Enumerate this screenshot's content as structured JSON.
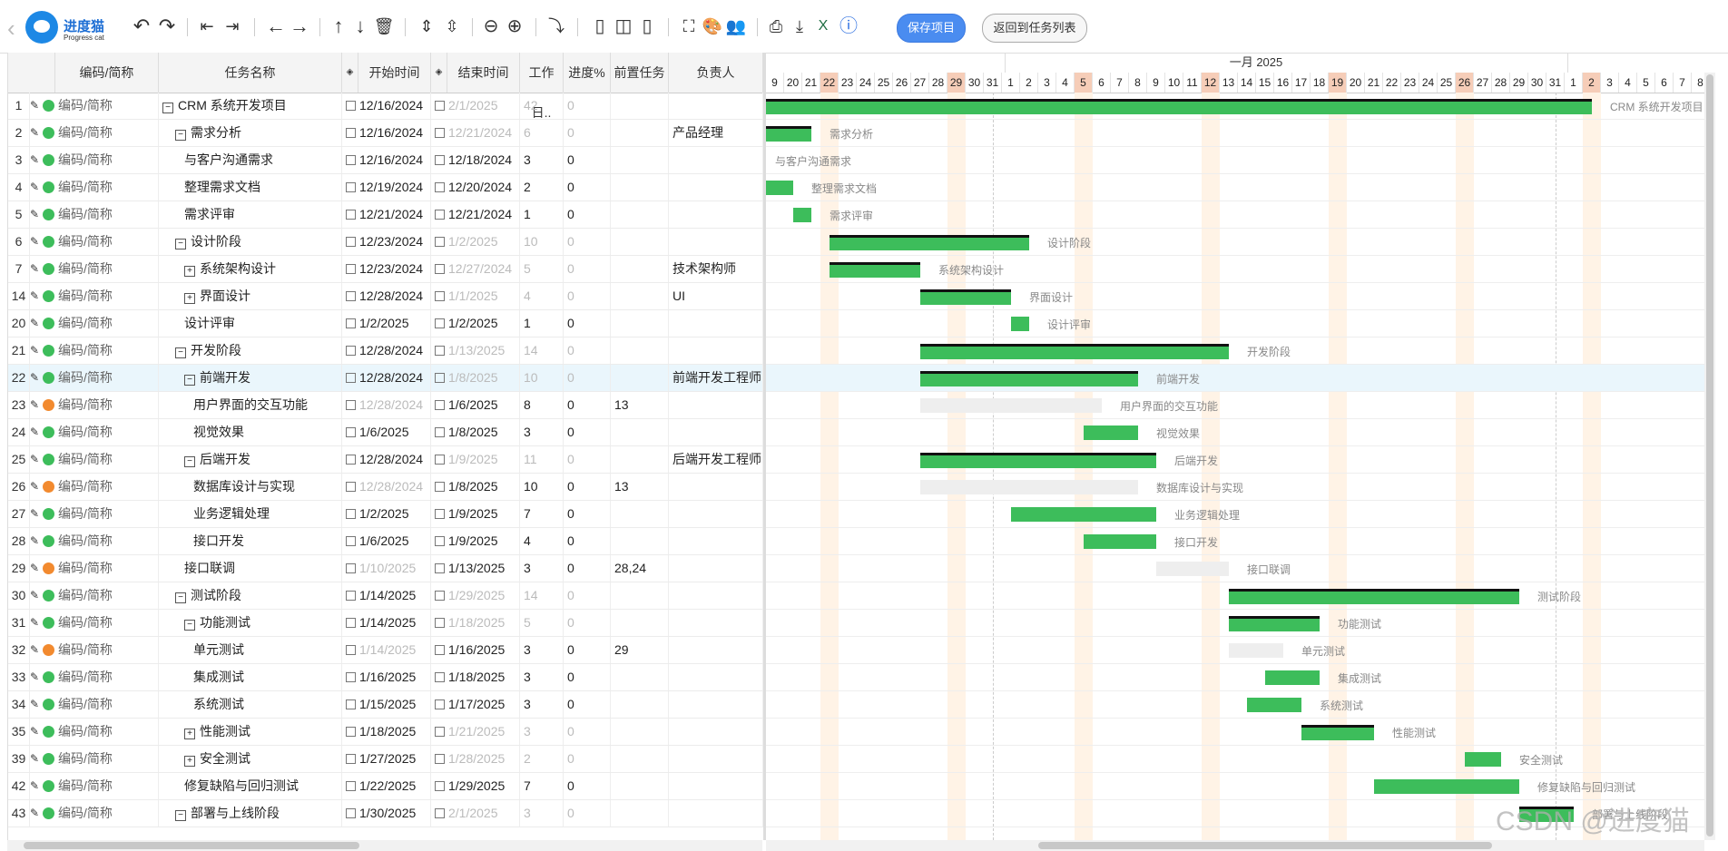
{
  "app": {
    "logo_name": "进度猫",
    "logo_sub": "Progress cat",
    "save_label": "保存项目",
    "back_label": "返回到任务列表"
  },
  "toolbar_icons": [
    "undo-icon",
    "redo-icon",
    "outdent-icon",
    "indent-icon",
    "move-left-icon",
    "move-right-icon",
    "move-up-icon",
    "move-down-icon",
    "delete-icon",
    "expand-rows-icon",
    "collapse-rows-icon",
    "zoom-out-icon",
    "zoom-in-icon",
    "share-icon",
    "layout-left-icon",
    "layout-split-icon",
    "layout-right-icon",
    "fullscreen-icon",
    "palette-icon",
    "users-icon",
    "print-icon",
    "download-icon",
    "excel-icon",
    "help-icon"
  ],
  "grid": {
    "headers": [
      "编码/简称",
      "任务名称",
      "开始时间",
      "结束时间",
      "工作日..",
      "进度%",
      "前置任务",
      "负责人"
    ],
    "rows": [
      {
        "id": "1",
        "status": "green",
        "code": "编码/简称",
        "toggle": "minus",
        "indent": 0,
        "name": "CRM 系统开发项目",
        "start": "12/16/2024",
        "end": "2/1/2025",
        "days": "42",
        "progress": "0",
        "pred": "",
        "owner": "",
        "start_dim": false,
        "end_dim": true,
        "days_dim": true
      },
      {
        "id": "2",
        "status": "green",
        "code": "编码/简称",
        "toggle": "minus",
        "indent": 1,
        "name": "需求分析",
        "start": "12/16/2024",
        "end": "12/21/2024",
        "days": "6",
        "progress": "0",
        "pred": "",
        "owner": "产品经理",
        "start_dim": false,
        "end_dim": true,
        "days_dim": true
      },
      {
        "id": "3",
        "status": "green",
        "code": "编码/简称",
        "toggle": "",
        "indent": 2,
        "name": "与客户沟通需求",
        "start": "12/16/2024",
        "end": "12/18/2024",
        "days": "3",
        "progress": "0",
        "pred": "",
        "owner": "",
        "start_dim": false,
        "end_dim": false,
        "days_dim": false
      },
      {
        "id": "4",
        "status": "green",
        "code": "编码/简称",
        "toggle": "",
        "indent": 2,
        "name": "整理需求文档",
        "start": "12/19/2024",
        "end": "12/20/2024",
        "days": "2",
        "progress": "0",
        "pred": "",
        "owner": "",
        "start_dim": false,
        "end_dim": false,
        "days_dim": false
      },
      {
        "id": "5",
        "status": "green",
        "code": "编码/简称",
        "toggle": "",
        "indent": 2,
        "name": "需求评审",
        "start": "12/21/2024",
        "end": "12/21/2024",
        "days": "1",
        "progress": "0",
        "pred": "",
        "owner": "",
        "start_dim": false,
        "end_dim": false,
        "days_dim": false
      },
      {
        "id": "6",
        "status": "green",
        "code": "编码/简称",
        "toggle": "minus",
        "indent": 1,
        "name": "设计阶段",
        "start": "12/23/2024",
        "end": "1/2/2025",
        "days": "10",
        "progress": "0",
        "pred": "",
        "owner": "",
        "start_dim": false,
        "end_dim": true,
        "days_dim": true
      },
      {
        "id": "7",
        "status": "green",
        "code": "编码/简称",
        "toggle": "plus",
        "indent": 2,
        "name": "系统架构设计",
        "start": "12/23/2024",
        "end": "12/27/2024",
        "days": "5",
        "progress": "0",
        "pred": "",
        "owner": "技术架构师",
        "start_dim": false,
        "end_dim": true,
        "days_dim": true
      },
      {
        "id": "14",
        "status": "green",
        "code": "编码/简称",
        "toggle": "plus",
        "indent": 2,
        "name": "界面设计",
        "start": "12/28/2024",
        "end": "1/1/2025",
        "days": "4",
        "progress": "0",
        "pred": "",
        "owner": "UI",
        "start_dim": false,
        "end_dim": true,
        "days_dim": true
      },
      {
        "id": "20",
        "status": "green",
        "code": "编码/简称",
        "toggle": "",
        "indent": 2,
        "name": "设计评审",
        "start": "1/2/2025",
        "end": "1/2/2025",
        "days": "1",
        "progress": "0",
        "pred": "",
        "owner": "",
        "start_dim": false,
        "end_dim": false,
        "days_dim": false
      },
      {
        "id": "21",
        "status": "green",
        "code": "编码/简称",
        "toggle": "minus",
        "indent": 1,
        "name": "开发阶段",
        "start": "12/28/2024",
        "end": "1/13/2025",
        "days": "14",
        "progress": "0",
        "pred": "",
        "owner": "",
        "start_dim": false,
        "end_dim": true,
        "days_dim": true
      },
      {
        "id": "22",
        "status": "green",
        "code": "编码/简称",
        "toggle": "minus",
        "indent": 2,
        "name": "前端开发",
        "start": "12/28/2024",
        "end": "1/8/2025",
        "days": "10",
        "progress": "0",
        "pred": "",
        "owner": "前端开发工程师",
        "start_dim": false,
        "end_dim": true,
        "days_dim": true,
        "selected": true
      },
      {
        "id": "23",
        "status": "orange",
        "code": "编码/简称",
        "toggle": "",
        "indent": 3,
        "name": "用户界面的交互功能",
        "start": "12/28/2024",
        "end": "1/6/2025",
        "days": "8",
        "progress": "0",
        "pred": "13",
        "owner": "",
        "start_dim": true,
        "end_dim": false,
        "days_dim": false
      },
      {
        "id": "24",
        "status": "green",
        "code": "编码/简称",
        "toggle": "",
        "indent": 3,
        "name": "视觉效果",
        "start": "1/6/2025",
        "end": "1/8/2025",
        "days": "3",
        "progress": "0",
        "pred": "",
        "owner": "",
        "start_dim": false,
        "end_dim": false,
        "days_dim": false
      },
      {
        "id": "25",
        "status": "green",
        "code": "编码/简称",
        "toggle": "minus",
        "indent": 2,
        "name": "后端开发",
        "start": "12/28/2024",
        "end": "1/9/2025",
        "days": "11",
        "progress": "0",
        "pred": "",
        "owner": "后端开发工程师",
        "start_dim": false,
        "end_dim": true,
        "days_dim": true
      },
      {
        "id": "26",
        "status": "orange",
        "code": "编码/简称",
        "toggle": "",
        "indent": 3,
        "name": "数据库设计与实现",
        "start": "12/28/2024",
        "end": "1/8/2025",
        "days": "10",
        "progress": "0",
        "pred": "13",
        "owner": "",
        "start_dim": true,
        "end_dim": false,
        "days_dim": false
      },
      {
        "id": "27",
        "status": "green",
        "code": "编码/简称",
        "toggle": "",
        "indent": 3,
        "name": "业务逻辑处理",
        "start": "1/2/2025",
        "end": "1/9/2025",
        "days": "7",
        "progress": "0",
        "pred": "",
        "owner": "",
        "start_dim": false,
        "end_dim": false,
        "days_dim": false
      },
      {
        "id": "28",
        "status": "green",
        "code": "编码/简称",
        "toggle": "",
        "indent": 3,
        "name": "接口开发",
        "start": "1/6/2025",
        "end": "1/9/2025",
        "days": "4",
        "progress": "0",
        "pred": "",
        "owner": "",
        "start_dim": false,
        "end_dim": false,
        "days_dim": false
      },
      {
        "id": "29",
        "status": "orange",
        "code": "编码/简称",
        "toggle": "",
        "indent": 2,
        "name": "接口联调",
        "start": "1/10/2025",
        "end": "1/13/2025",
        "days": "3",
        "progress": "0",
        "pred": "28,24",
        "owner": "",
        "start_dim": true,
        "end_dim": false,
        "days_dim": false
      },
      {
        "id": "30",
        "status": "green",
        "code": "编码/简称",
        "toggle": "minus",
        "indent": 1,
        "name": "测试阶段",
        "start": "1/14/2025",
        "end": "1/29/2025",
        "days": "14",
        "progress": "0",
        "pred": "",
        "owner": "",
        "start_dim": false,
        "end_dim": true,
        "days_dim": true
      },
      {
        "id": "31",
        "status": "green",
        "code": "编码/简称",
        "toggle": "minus",
        "indent": 2,
        "name": "功能测试",
        "start": "1/14/2025",
        "end": "1/18/2025",
        "days": "5",
        "progress": "0",
        "pred": "",
        "owner": "",
        "start_dim": false,
        "end_dim": true,
        "days_dim": true
      },
      {
        "id": "32",
        "status": "orange",
        "code": "编码/简称",
        "toggle": "",
        "indent": 3,
        "name": "单元测试",
        "start": "1/14/2025",
        "end": "1/16/2025",
        "days": "3",
        "progress": "0",
        "pred": "29",
        "owner": "",
        "start_dim": true,
        "end_dim": false,
        "days_dim": false
      },
      {
        "id": "33",
        "status": "green",
        "code": "编码/简称",
        "toggle": "",
        "indent": 3,
        "name": "集成测试",
        "start": "1/16/2025",
        "end": "1/18/2025",
        "days": "3",
        "progress": "0",
        "pred": "",
        "owner": "",
        "start_dim": false,
        "end_dim": false,
        "days_dim": false
      },
      {
        "id": "34",
        "status": "green",
        "code": "编码/简称",
        "toggle": "",
        "indent": 3,
        "name": "系统测试",
        "start": "1/15/2025",
        "end": "1/17/2025",
        "days": "3",
        "progress": "0",
        "pred": "",
        "owner": "",
        "start_dim": false,
        "end_dim": false,
        "days_dim": false
      },
      {
        "id": "35",
        "status": "green",
        "code": "编码/简称",
        "toggle": "plus",
        "indent": 2,
        "name": "性能测试",
        "start": "1/18/2025",
        "end": "1/21/2025",
        "days": "3",
        "progress": "0",
        "pred": "",
        "owner": "",
        "start_dim": false,
        "end_dim": true,
        "days_dim": true
      },
      {
        "id": "39",
        "status": "green",
        "code": "编码/简称",
        "toggle": "plus",
        "indent": 2,
        "name": "安全测试",
        "start": "1/27/2025",
        "end": "1/28/2025",
        "days": "2",
        "progress": "0",
        "pred": "",
        "owner": "",
        "start_dim": false,
        "end_dim": true,
        "days_dim": true
      },
      {
        "id": "42",
        "status": "green",
        "code": "编码/简称",
        "toggle": "",
        "indent": 2,
        "name": "修复缺陷与回归测试",
        "start": "1/22/2025",
        "end": "1/29/2025",
        "days": "7",
        "progress": "0",
        "pred": "",
        "owner": "",
        "start_dim": false,
        "end_dim": false,
        "days_dim": false
      },
      {
        "id": "43",
        "status": "green",
        "code": "编码/简称",
        "toggle": "minus",
        "indent": 1,
        "name": "部署与上线阶段",
        "start": "1/30/2025",
        "end": "2/1/2025",
        "days": "3",
        "progress": "0",
        "pred": "",
        "owner": "",
        "start_dim": false,
        "end_dim": true,
        "days_dim": true
      }
    ]
  },
  "gantt": {
    "month_label": "一月 2025",
    "days": [
      "9",
      "20",
      "21",
      "22",
      "23",
      "24",
      "25",
      "26",
      "27",
      "28",
      "29",
      "30",
      "31",
      "1",
      "2",
      "3",
      "4",
      "5",
      "6",
      "7",
      "8",
      "9",
      "10",
      "11",
      "12",
      "13",
      "14",
      "15",
      "16",
      "17",
      "18",
      "19",
      "20",
      "21",
      "22",
      "23",
      "24",
      "25",
      "26",
      "27",
      "28",
      "29",
      "30",
      "31",
      "1",
      "2",
      "3",
      "4",
      "5",
      "6",
      "7",
      "8",
      "9"
    ],
    "weekend_index": [
      3,
      10,
      17,
      24,
      31,
      38,
      45
    ],
    "bars": [
      {
        "row": 0,
        "start": 0,
        "len": 45.5,
        "kind": "sum",
        "label": "CRM 系统开发项目"
      },
      {
        "row": 1,
        "start": 0,
        "len": 2.5,
        "kind": "sum",
        "label": "需求分析"
      },
      {
        "row": 2,
        "start": 0,
        "len": 0,
        "kind": "task",
        "label": "与客户沟通需求"
      },
      {
        "row": 3,
        "start": 0,
        "len": 1.5,
        "kind": "task",
        "label": "整理需求文档"
      },
      {
        "row": 4,
        "start": 1.5,
        "len": 1,
        "kind": "task",
        "label": "需求评审"
      },
      {
        "row": 5,
        "start": 3.5,
        "len": 11,
        "kind": "sum",
        "label": "设计阶段"
      },
      {
        "row": 6,
        "start": 3.5,
        "len": 5,
        "kind": "sum",
        "label": "系统架构设计"
      },
      {
        "row": 7,
        "start": 8.5,
        "len": 5,
        "kind": "sum",
        "label": "界面设计"
      },
      {
        "row": 8,
        "start": 13.5,
        "len": 1,
        "kind": "task",
        "label": "设计评审"
      },
      {
        "row": 9,
        "start": 8.5,
        "len": 17,
        "kind": "sum",
        "label": "开发阶段"
      },
      {
        "row": 10,
        "start": 8.5,
        "len": 12,
        "kind": "sum",
        "label": "前端开发"
      },
      {
        "row": 11,
        "start": 8.5,
        "len": 10,
        "kind": "ghost",
        "label": "用户界面的交互功能"
      },
      {
        "row": 12,
        "start": 17.5,
        "len": 3,
        "kind": "task",
        "label": "视觉效果"
      },
      {
        "row": 13,
        "start": 8.5,
        "len": 13,
        "kind": "sum",
        "label": "后端开发"
      },
      {
        "row": 14,
        "start": 8.5,
        "len": 12,
        "kind": "ghost",
        "label": "数据库设计与实现"
      },
      {
        "row": 15,
        "start": 13.5,
        "len": 8,
        "kind": "task",
        "label": "业务逻辑处理"
      },
      {
        "row": 16,
        "start": 17.5,
        "len": 4,
        "kind": "task",
        "label": "接口开发"
      },
      {
        "row": 17,
        "start": 21.5,
        "len": 4,
        "kind": "ghost",
        "label": "接口联调"
      },
      {
        "row": 18,
        "start": 25.5,
        "len": 16,
        "kind": "sum",
        "label": "测试阶段"
      },
      {
        "row": 19,
        "start": 25.5,
        "len": 5,
        "kind": "sum",
        "label": "功能测试"
      },
      {
        "row": 20,
        "start": 25.5,
        "len": 3,
        "kind": "ghost",
        "label": "单元测试"
      },
      {
        "row": 21,
        "start": 27.5,
        "len": 3,
        "kind": "task",
        "label": "集成测试"
      },
      {
        "row": 22,
        "start": 26.5,
        "len": 3,
        "kind": "task",
        "label": "系统测试"
      },
      {
        "row": 23,
        "start": 29.5,
        "len": 4,
        "kind": "sum",
        "label": "性能测试"
      },
      {
        "row": 24,
        "start": 38.5,
        "len": 2,
        "kind": "task",
        "label": "安全测试"
      },
      {
        "row": 25,
        "start": 33.5,
        "len": 8,
        "kind": "task",
        "label": "修复缺陷与回归测试"
      },
      {
        "row": 26,
        "start": 41.5,
        "len": 3,
        "kind": "sum",
        "label": "部署与上线阶段"
      }
    ]
  },
  "watermark": "CSDN @进度猫"
}
